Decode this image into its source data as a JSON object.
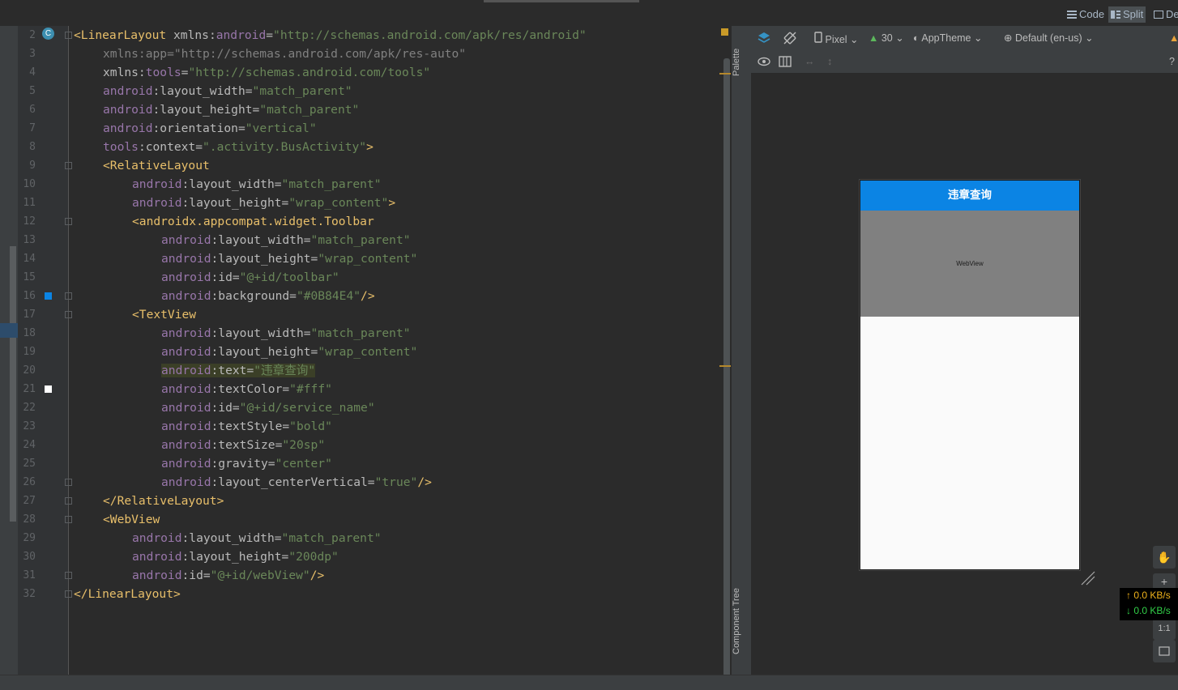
{
  "editor_mode": {
    "code": "Code",
    "split": "Split",
    "design": "De"
  },
  "gutter": {
    "line_numbers": [
      "2",
      "3",
      "4",
      "5",
      "6",
      "7",
      "8",
      "9",
      "10",
      "11",
      "12",
      "13",
      "14",
      "15",
      "16",
      "17",
      "18",
      "19",
      "20",
      "21",
      "22",
      "23",
      "24",
      "25",
      "26",
      "27",
      "28",
      "29",
      "30",
      "31",
      "32"
    ]
  },
  "code_lines": [
    {
      "indent": 0,
      "parts": [
        [
          "tag",
          "<LinearLayout "
        ],
        [
          "attr",
          "xmlns:"
        ],
        [
          "ns",
          "android"
        ],
        [
          "attr",
          "="
        ],
        [
          "val",
          "\"http://schemas.android.com/apk/res/android\""
        ]
      ]
    },
    {
      "indent": 1,
      "parts": [
        [
          "dim",
          "xmlns:app=\"http://schemas.android.com/apk/res-auto\""
        ]
      ]
    },
    {
      "indent": 1,
      "parts": [
        [
          "attr",
          "xmlns:"
        ],
        [
          "ns",
          "tools"
        ],
        [
          "attr",
          "="
        ],
        [
          "val",
          "\"http://schemas.android.com/tools\""
        ]
      ]
    },
    {
      "indent": 1,
      "parts": [
        [
          "ns",
          "android"
        ],
        [
          "attr",
          ":layout_width="
        ],
        [
          "val",
          "\"match_parent\""
        ]
      ]
    },
    {
      "indent": 1,
      "parts": [
        [
          "ns",
          "android"
        ],
        [
          "attr",
          ":layout_height="
        ],
        [
          "val",
          "\"match_parent\""
        ]
      ]
    },
    {
      "indent": 1,
      "parts": [
        [
          "ns",
          "android"
        ],
        [
          "attr",
          ":orientation="
        ],
        [
          "val",
          "\"vertical\""
        ]
      ]
    },
    {
      "indent": 1,
      "parts": [
        [
          "ns",
          "tools"
        ],
        [
          "attr",
          ":context="
        ],
        [
          "val",
          "\".activity.BusActivity\""
        ],
        [
          "tag",
          ">"
        ]
      ]
    },
    {
      "indent": 1,
      "parts": [
        [
          "tag",
          "<RelativeLayout"
        ]
      ]
    },
    {
      "indent": 2,
      "parts": [
        [
          "ns",
          "android"
        ],
        [
          "attr",
          ":layout_width="
        ],
        [
          "val",
          "\"match_parent\""
        ]
      ]
    },
    {
      "indent": 2,
      "parts": [
        [
          "ns",
          "android"
        ],
        [
          "attr",
          ":layout_height="
        ],
        [
          "val",
          "\"wrap_content\""
        ],
        [
          "tag",
          ">"
        ]
      ]
    },
    {
      "indent": 2,
      "parts": [
        [
          "tag",
          "<androidx.appcompat.widget.Toolbar"
        ]
      ]
    },
    {
      "indent": 3,
      "parts": [
        [
          "ns",
          "android"
        ],
        [
          "attr",
          ":layout_width="
        ],
        [
          "val",
          "\"match_parent\""
        ]
      ]
    },
    {
      "indent": 3,
      "parts": [
        [
          "ns",
          "android"
        ],
        [
          "attr",
          ":layout_height="
        ],
        [
          "val",
          "\"wrap_content\""
        ]
      ]
    },
    {
      "indent": 3,
      "parts": [
        [
          "ns",
          "android"
        ],
        [
          "attr",
          ":id="
        ],
        [
          "val",
          "\"@+id/toolbar\""
        ]
      ]
    },
    {
      "indent": 3,
      "parts": [
        [
          "ns",
          "android"
        ],
        [
          "attr",
          ":background="
        ],
        [
          "val",
          "\"#0B84E4\""
        ],
        [
          "tag",
          "/>"
        ]
      ]
    },
    {
      "indent": 2,
      "parts": [
        [
          "tag",
          "<TextView"
        ]
      ]
    },
    {
      "indent": 3,
      "parts": [
        [
          "ns",
          "android"
        ],
        [
          "attr",
          ":layout_width="
        ],
        [
          "val",
          "\"match_parent\""
        ]
      ]
    },
    {
      "indent": 3,
      "parts": [
        [
          "ns",
          "android"
        ],
        [
          "attr",
          ":layout_height="
        ],
        [
          "val",
          "\"wrap_content\""
        ]
      ]
    },
    {
      "indent": 3,
      "highlight": true,
      "parts": [
        [
          "ns",
          "android"
        ],
        [
          "attr",
          ":text="
        ],
        [
          "val",
          "\"违章查询\""
        ]
      ]
    },
    {
      "indent": 3,
      "parts": [
        [
          "ns",
          "android"
        ],
        [
          "attr",
          ":textColor="
        ],
        [
          "val",
          "\"#fff\""
        ]
      ]
    },
    {
      "indent": 3,
      "parts": [
        [
          "ns",
          "android"
        ],
        [
          "attr",
          ":id="
        ],
        [
          "val",
          "\"@+id/service_name\""
        ]
      ]
    },
    {
      "indent": 3,
      "parts": [
        [
          "ns",
          "android"
        ],
        [
          "attr",
          ":textStyle="
        ],
        [
          "val",
          "\"bold\""
        ]
      ]
    },
    {
      "indent": 3,
      "parts": [
        [
          "ns",
          "android"
        ],
        [
          "attr",
          ":textSize="
        ],
        [
          "val",
          "\"20sp\""
        ]
      ]
    },
    {
      "indent": 3,
      "parts": [
        [
          "ns",
          "android"
        ],
        [
          "attr",
          ":gravity="
        ],
        [
          "val",
          "\"center\""
        ]
      ]
    },
    {
      "indent": 3,
      "parts": [
        [
          "ns",
          "android"
        ],
        [
          "attr",
          ":layout_centerVertical="
        ],
        [
          "val",
          "\"true\""
        ],
        [
          "tag",
          "/>"
        ]
      ]
    },
    {
      "indent": 1,
      "parts": [
        [
          "tag",
          "</RelativeLayout>"
        ]
      ]
    },
    {
      "indent": 1,
      "parts": [
        [
          "tag",
          "<WebView"
        ]
      ]
    },
    {
      "indent": 2,
      "parts": [
        [
          "ns",
          "android"
        ],
        [
          "attr",
          ":layout_width="
        ],
        [
          "val",
          "\"match_parent\""
        ]
      ]
    },
    {
      "indent": 2,
      "parts": [
        [
          "ns",
          "android"
        ],
        [
          "attr",
          ":layout_height="
        ],
        [
          "val",
          "\"200dp\""
        ]
      ]
    },
    {
      "indent": 2,
      "parts": [
        [
          "ns",
          "android"
        ],
        [
          "attr",
          ":id="
        ],
        [
          "val",
          "\"@+id/webView\""
        ],
        [
          "tag",
          "/>"
        ]
      ]
    },
    {
      "indent": 0,
      "parts": [
        [
          "tag",
          "</LinearLayout>"
        ]
      ]
    }
  ],
  "side_tabs": {
    "palette": "Palette",
    "component_tree": "Component Tree"
  },
  "design_toolbar": {
    "device": "Pixel",
    "api": "30",
    "theme": "AppTheme",
    "locale": "Default (en-us)"
  },
  "preview": {
    "toolbar_title": "违章查询",
    "webview_label": "WebView",
    "toolbar_color": "#0B84E4"
  },
  "zoom": {
    "one_to_one": "1:1",
    "plus": "+"
  },
  "network": {
    "up": "↑ 0.0 KB/s",
    "down": "↓ 0.0 KB/s"
  },
  "colors": {
    "tag": "#e8bf6a",
    "namespace": "#9876aa",
    "value": "#6a8759",
    "accent_blue": "#0b84e4"
  }
}
